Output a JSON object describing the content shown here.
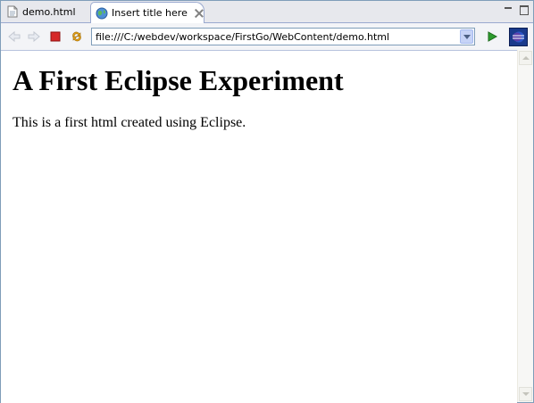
{
  "tabs": [
    {
      "label": "demo.html",
      "icon": "html-file-icon",
      "active": false
    },
    {
      "label": "Insert title here",
      "icon": "globe-icon",
      "active": true
    }
  ],
  "toolbar": {
    "url": "file:///C:/webdev/workspace/FirstGo/WebContent/demo.html",
    "icons": [
      "back-icon",
      "forward-icon",
      "stop-icon",
      "refresh-icon",
      "go-icon",
      "eclipse-icon"
    ]
  },
  "page": {
    "heading": "A First Eclipse Experiment",
    "paragraph": "This is a first html created using Eclipse."
  },
  "colors": {
    "stop": "#d62828",
    "go": "#2e9c2e",
    "tab_strip": "#e7e8ed",
    "border": "#7f9db9"
  }
}
